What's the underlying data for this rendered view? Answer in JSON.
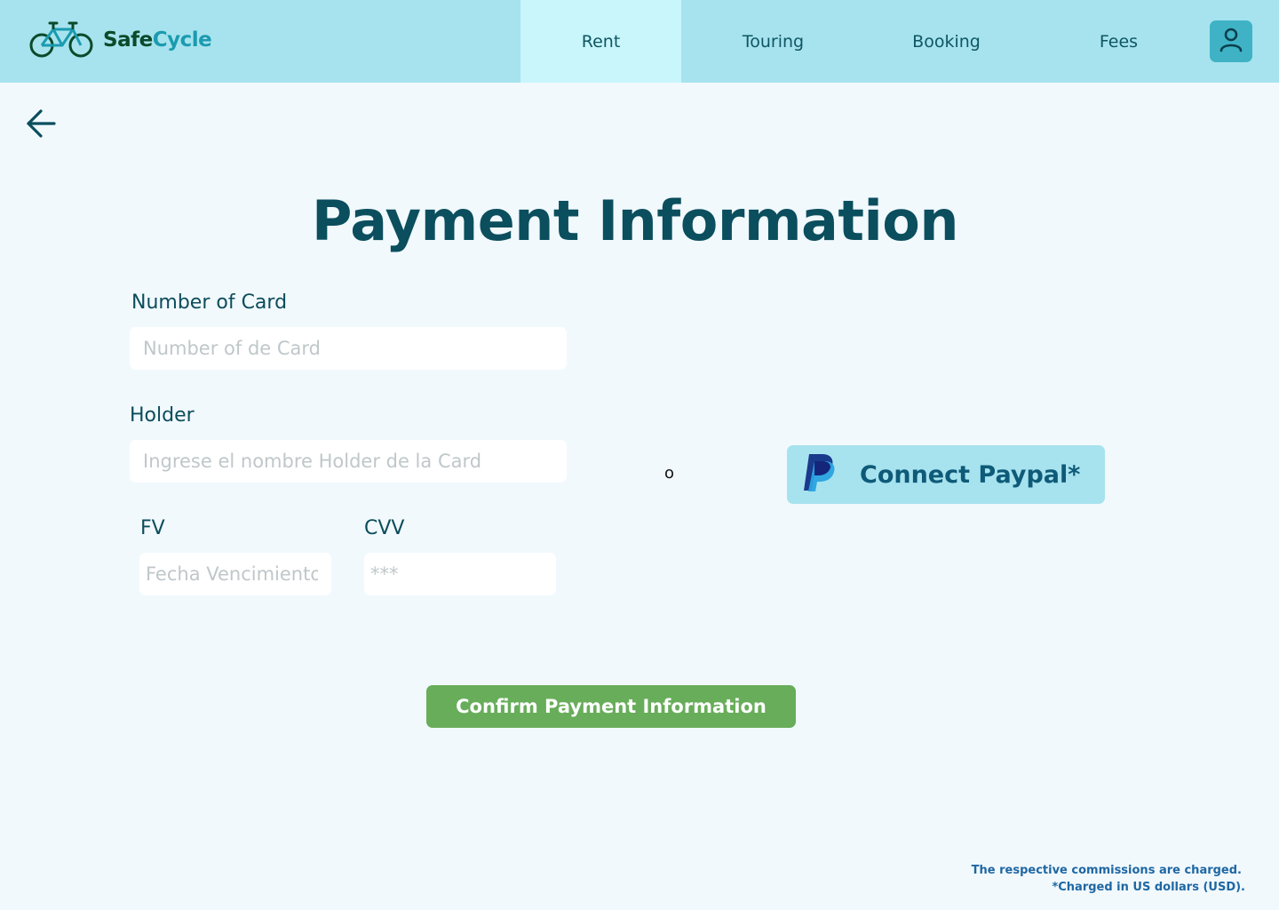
{
  "brand": {
    "name_part1": "Safe",
    "name_part2": "Cycle",
    "logo_icon": "bicycle-icon"
  },
  "nav": {
    "tabs": [
      {
        "label": "Rent",
        "active": true
      },
      {
        "label": "Touring",
        "active": false
      },
      {
        "label": "Booking",
        "active": false
      },
      {
        "label": "Fees",
        "active": false
      }
    ],
    "profile_icon": "user-icon"
  },
  "back_icon": "arrow-left-icon",
  "page_title": "Payment Information",
  "form": {
    "card_number": {
      "label": "Number of Card",
      "placeholder": "Number of de Card",
      "value": ""
    },
    "holder": {
      "label": "Holder",
      "placeholder": "Ingrese el nombre Holder de la Card",
      "value": ""
    },
    "expiry": {
      "label": "FV",
      "placeholder": "Fecha Vencimiento",
      "value": ""
    },
    "cvv": {
      "label": "CVV",
      "placeholder": "***",
      "value": ""
    }
  },
  "separator": "o",
  "paypal": {
    "label": "Connect Paypal*",
    "icon": "paypal-icon"
  },
  "confirm_label": "Confirm Payment Information",
  "notes": {
    "commissions": "The respective commissions are charged.",
    "currency": "*Charged in US dollars (USD)."
  },
  "colors": {
    "header_bg": "#a7e3ee",
    "active_tab_bg": "#c8f6fb",
    "page_bg": "#f1f9fd",
    "title": "#0b4e5e",
    "confirm_bg": "#68ad5a",
    "profile_bg": "#3fb3c5"
  }
}
